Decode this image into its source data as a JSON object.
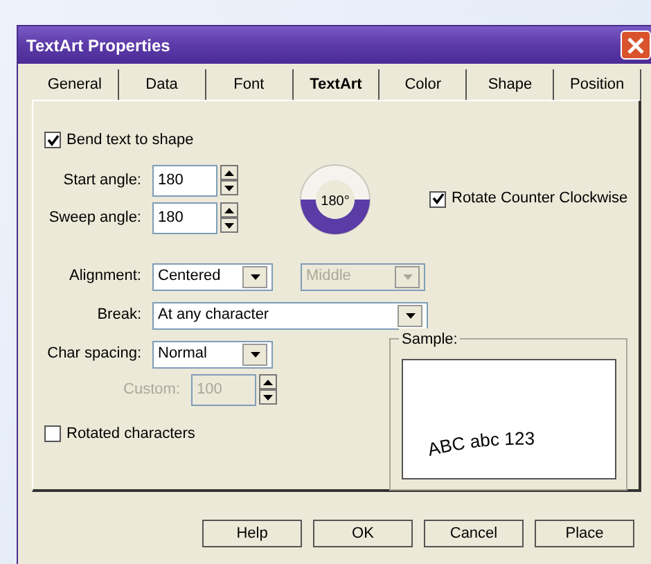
{
  "window": {
    "title": "TextArt Properties"
  },
  "tabs": [
    {
      "label": "General",
      "selected": false
    },
    {
      "label": "Data",
      "selected": false
    },
    {
      "label": "Font",
      "selected": false
    },
    {
      "label": "TextArt",
      "selected": true
    },
    {
      "label": "Color",
      "selected": false
    },
    {
      "label": "Shape",
      "selected": false
    },
    {
      "label": "Position",
      "selected": false
    }
  ],
  "bend_text": {
    "label": "Bend text to shape",
    "checked": true
  },
  "start_angle": {
    "label": "Start angle:",
    "value": "180"
  },
  "sweep_angle": {
    "label": "Sweep angle:",
    "value": "180"
  },
  "dial": {
    "reading": "180°"
  },
  "rotate_counter_clockwise": {
    "label": "Rotate Counter Clockwise",
    "checked": true
  },
  "alignment": {
    "label": "Alignment:",
    "value": "Centered",
    "disabled": false
  },
  "vertical_alignment": {
    "value": "Middle",
    "disabled": true
  },
  "break": {
    "label": "Break:",
    "value": "At any character",
    "disabled": false
  },
  "char_spacing": {
    "label": "Char spacing:",
    "value": "Normal",
    "disabled": false
  },
  "custom": {
    "label": "Custom:",
    "value": "100",
    "disabled": true
  },
  "rotated_characters": {
    "label": "Rotated characters",
    "checked": false
  },
  "sample": {
    "label": "Sample:",
    "text": "ABC abc 123"
  },
  "buttons": [
    {
      "label": "Help"
    },
    {
      "label": "OK"
    },
    {
      "label": "Cancel"
    },
    {
      "label": "Place"
    }
  ]
}
